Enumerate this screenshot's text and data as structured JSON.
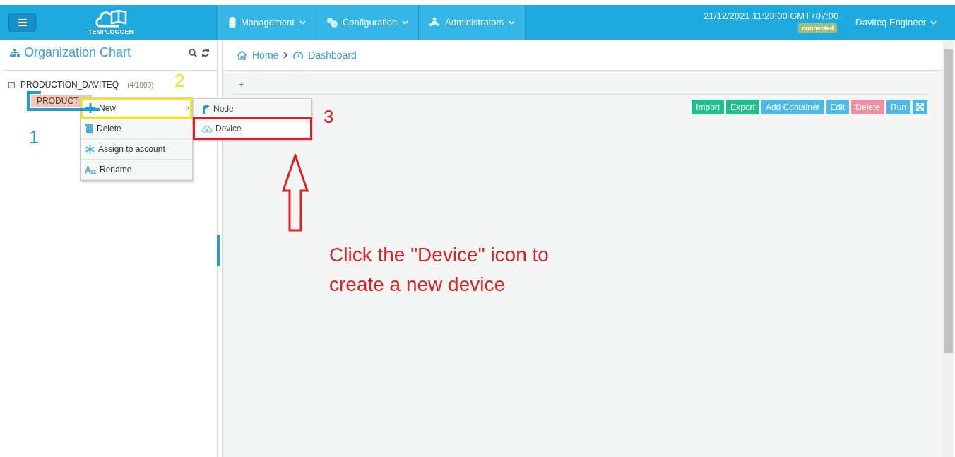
{
  "header": {
    "logo_text": "TEMPLOGGER",
    "nav": [
      {
        "label": "Management"
      },
      {
        "label": "Configuration"
      },
      {
        "label": "Administrators"
      }
    ],
    "datetime": "21/12/2021 11:23:00 GMT+07:00",
    "status": "connected",
    "user": "Daviteq Engineer"
  },
  "sidebar": {
    "title": "Organization Chart",
    "tree": [
      {
        "label": "PRODUCTION_DAVITEQ",
        "count": "(4/1000)",
        "expanded": true,
        "children": [
          {
            "label": "PRODUCT",
            "selected": true
          }
        ]
      }
    ]
  },
  "context_menu": {
    "items": [
      {
        "label": "New",
        "kind": "submenu",
        "selected": true
      },
      {
        "label": "Delete",
        "kind": "command",
        "selected": false
      },
      {
        "label": "Assign to account",
        "kind": "command",
        "selected": false
      },
      {
        "label": "Rename",
        "kind": "command",
        "selected": false
      }
    ],
    "submenu": [
      {
        "label": "Node",
        "selected": false
      },
      {
        "label": "Device",
        "selected": true
      }
    ]
  },
  "breadcrumb": [
    {
      "label": "Home"
    },
    {
      "label": "Dashboard"
    }
  ],
  "tab_add": "+",
  "toolbar": [
    {
      "label": "Import",
      "color": "#1fc08e"
    },
    {
      "label": "Export",
      "color": "#1fc08e"
    },
    {
      "label": "Add Container",
      "color": "#4cb9e6"
    },
    {
      "label": "Edit",
      "color": "#4cb9e6"
    },
    {
      "label": "Delete",
      "color": "#f28ea2"
    },
    {
      "label": "Run",
      "color": "#4cb9e6"
    }
  ],
  "annotations": {
    "step_1": "1",
    "step_2": "2",
    "step_3": "3",
    "caption": "Click the \"Device\" icon to create a new device"
  }
}
